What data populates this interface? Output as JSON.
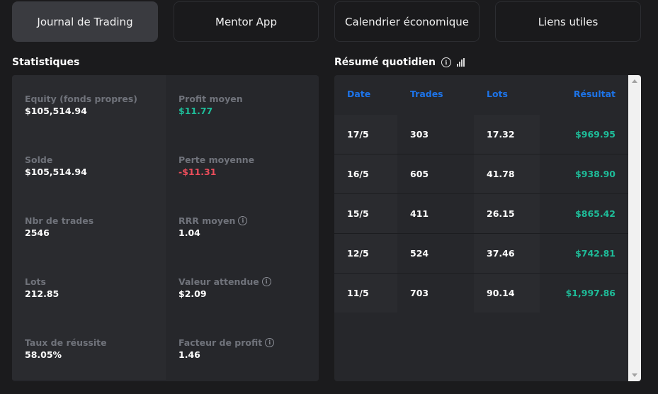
{
  "tabs": [
    {
      "label": "Journal de Trading",
      "active": true
    },
    {
      "label": "Mentor App",
      "active": false
    },
    {
      "label": "Calendrier économique",
      "active": false
    },
    {
      "label": "Liens utiles",
      "active": false
    }
  ],
  "stats": {
    "title": "Statistiques",
    "rows": [
      {
        "left": {
          "label": "Equity (fonds propres)",
          "value": "$105,514.94"
        },
        "right": {
          "label": "Profit moyen",
          "value": "$11.77"
        }
      },
      {
        "left": {
          "label": "Solde",
          "value": "$105,514.94"
        },
        "right": {
          "label": "Perte moyenne",
          "value": "-$11.31"
        }
      },
      {
        "left": {
          "label": "Nbr de trades",
          "value": "2546"
        },
        "right": {
          "label": "RRR moyen",
          "value": "1.04"
        }
      },
      {
        "left": {
          "label": "Lots",
          "value": "212.85"
        },
        "right": {
          "label": "Valeur attendue",
          "value": "$2.09"
        }
      },
      {
        "left": {
          "label": "Taux de réussite",
          "value": "58.05%"
        },
        "right": {
          "label": "Facteur de profit",
          "value": "1.46"
        }
      }
    ]
  },
  "daily": {
    "title": "Résumé quotidien",
    "headers": {
      "date": "Date",
      "trades": "Trades",
      "lots": "Lots",
      "result": "Résultat"
    },
    "rows": [
      {
        "date": "17/5",
        "trades": "303",
        "lots": "17.32",
        "result": "$969.95"
      },
      {
        "date": "16/5",
        "trades": "605",
        "lots": "41.78",
        "result": "$938.90"
      },
      {
        "date": "15/5",
        "trades": "411",
        "lots": "26.15",
        "result": "$865.42"
      },
      {
        "date": "12/5",
        "trades": "524",
        "lots": "37.46",
        "result": "$742.81"
      },
      {
        "date": "11/5",
        "trades": "703",
        "lots": "90.14",
        "result": "$1,997.86"
      }
    ]
  },
  "colors": {
    "positive": "#1ebc99",
    "negative": "#ec4d5b",
    "header_accent": "#1d74e9"
  }
}
